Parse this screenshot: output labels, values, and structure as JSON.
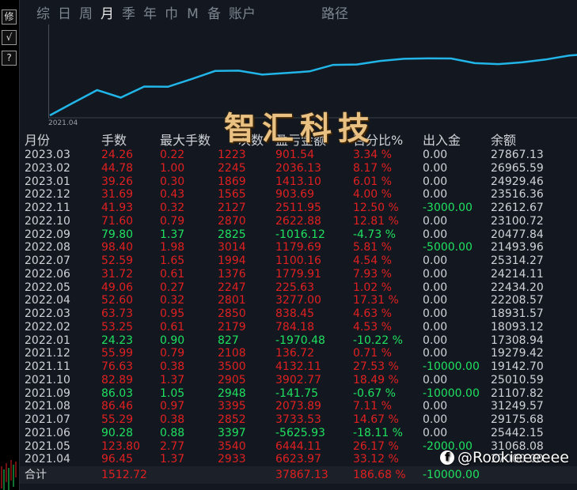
{
  "leftbar": {
    "buttons": [
      "修",
      "√",
      "?"
    ]
  },
  "tabs": [
    "综",
    "日",
    "周",
    "月",
    "季",
    "年",
    "巾",
    "M",
    "备",
    "账户"
  ],
  "active_tab": "月",
  "route_tab": "路径",
  "chart": {
    "start_label": "2021.04",
    "line_color": "#21b5e8",
    "values": [
      6623.97,
      13068.08,
      19442.15,
      15629.68,
      21249.57,
      21107.82,
      25010.59,
      29142.7,
      29279.42,
      27308.94,
      28093.12,
      28931.57,
      32208.57,
      32434.2,
      34214.11,
      35314.27,
      35493.96,
      35477.84,
      33100.72,
      32612.67,
      33516.36,
      34929.46,
      36965.59,
      37867.13
    ]
  },
  "watermark": "智汇科技",
  "table": {
    "headers": [
      "月份",
      "手数",
      "最大手数",
      "次数",
      "盈亏金额",
      "百分比%",
      "出入金",
      "余额"
    ],
    "rows": [
      [
        "2023.03",
        "24.26",
        "0.22",
        "1223",
        "901.54",
        "3.34 %",
        "0.00",
        "27867.13"
      ],
      [
        "2023.02",
        "44.78",
        "1.00",
        "2245",
        "2036.13",
        "8.17 %",
        "0.00",
        "26965.59"
      ],
      [
        "2023.01",
        "39.26",
        "0.30",
        "1869",
        "1413.10",
        "6.01 %",
        "0.00",
        "24929.46"
      ],
      [
        "2022.12",
        "31.69",
        "0.43",
        "1565",
        "903.69",
        "4.00 %",
        "0.00",
        "23516.36"
      ],
      [
        "2022.11",
        "41.93",
        "0.32",
        "2127",
        "2511.95",
        "12.50 %",
        "-3000.00",
        "22612.67"
      ],
      [
        "2022.10",
        "71.60",
        "0.79",
        "2870",
        "2622.88",
        "12.81 %",
        "0.00",
        "23100.72"
      ],
      [
        "2022.09",
        "79.80",
        "1.37",
        "2825",
        "-1016.12",
        "-4.73 %",
        "0.00",
        "20477.84"
      ],
      [
        "2022.08",
        "98.40",
        "1.98",
        "3014",
        "1179.69",
        "5.81 %",
        "-5000.00",
        "21493.96"
      ],
      [
        "2022.07",
        "52.59",
        "1.65",
        "1994",
        "1100.16",
        "4.54 %",
        "0.00",
        "25314.27"
      ],
      [
        "2022.06",
        "31.72",
        "0.61",
        "1376",
        "1779.91",
        "7.93 %",
        "0.00",
        "24214.11"
      ],
      [
        "2022.05",
        "49.06",
        "0.27",
        "2247",
        "225.63",
        "1.02 %",
        "0.00",
        "22434.20"
      ],
      [
        "2022.04",
        "52.60",
        "0.32",
        "2801",
        "3277.00",
        "17.31 %",
        "0.00",
        "22208.57"
      ],
      [
        "2022.03",
        "63.73",
        "0.95",
        "2850",
        "838.45",
        "4.63 %",
        "0.00",
        "18931.57"
      ],
      [
        "2022.02",
        "53.25",
        "0.61",
        "2179",
        "784.18",
        "4.53 %",
        "0.00",
        "18093.12"
      ],
      [
        "2022.01",
        "24.23",
        "0.90",
        "827",
        "-1970.48",
        "-10.22 %",
        "0.00",
        "17308.94"
      ],
      [
        "2021.12",
        "55.99",
        "0.79",
        "2108",
        "136.72",
        "0.71 %",
        "0.00",
        "19279.42"
      ],
      [
        "2021.11",
        "76.63",
        "0.38",
        "3500",
        "4132.11",
        "27.53 %",
        "-10000.00",
        "19142.70"
      ],
      [
        "2021.10",
        "82.89",
        "1.37",
        "2905",
        "3902.77",
        "18.49 %",
        "0.00",
        "25010.59"
      ],
      [
        "2021.09",
        "86.03",
        "1.05",
        "2948",
        "-141.75",
        "-0.67 %",
        "-10000.00",
        "21107.82"
      ],
      [
        "2021.08",
        "86.46",
        "0.97",
        "3395",
        "2073.89",
        "7.11 %",
        "0.00",
        "31249.57"
      ],
      [
        "2021.07",
        "55.29",
        "0.38",
        "2852",
        "3733.53",
        "14.67 %",
        "0.00",
        "29175.68"
      ],
      [
        "2021.06",
        "90.28",
        "0.88",
        "3397",
        "-5625.93",
        "-18.11 %",
        "0.00",
        "25442.15"
      ],
      [
        "2021.05",
        "123.80",
        "2.77",
        "3540",
        "6444.11",
        "26.17 %",
        "-2000.00",
        "31068.08"
      ],
      [
        "2021.04",
        "96.45",
        "1.37",
        "2933",
        "6623.97",
        "33.12 %",
        "",
        "27000.00"
      ]
    ],
    "total": {
      "label": "合计",
      "lots": "1512.72",
      "pnl": "37867.13",
      "pct": "186.68 %",
      "flow": "-10000.00"
    }
  },
  "social": {
    "handle": "@Rookieeeeee",
    "icon": "facebook-icon"
  },
  "colors": {
    "up": "#e02020",
    "down": "#20e060",
    "neutral": "#cfd3d8"
  }
}
